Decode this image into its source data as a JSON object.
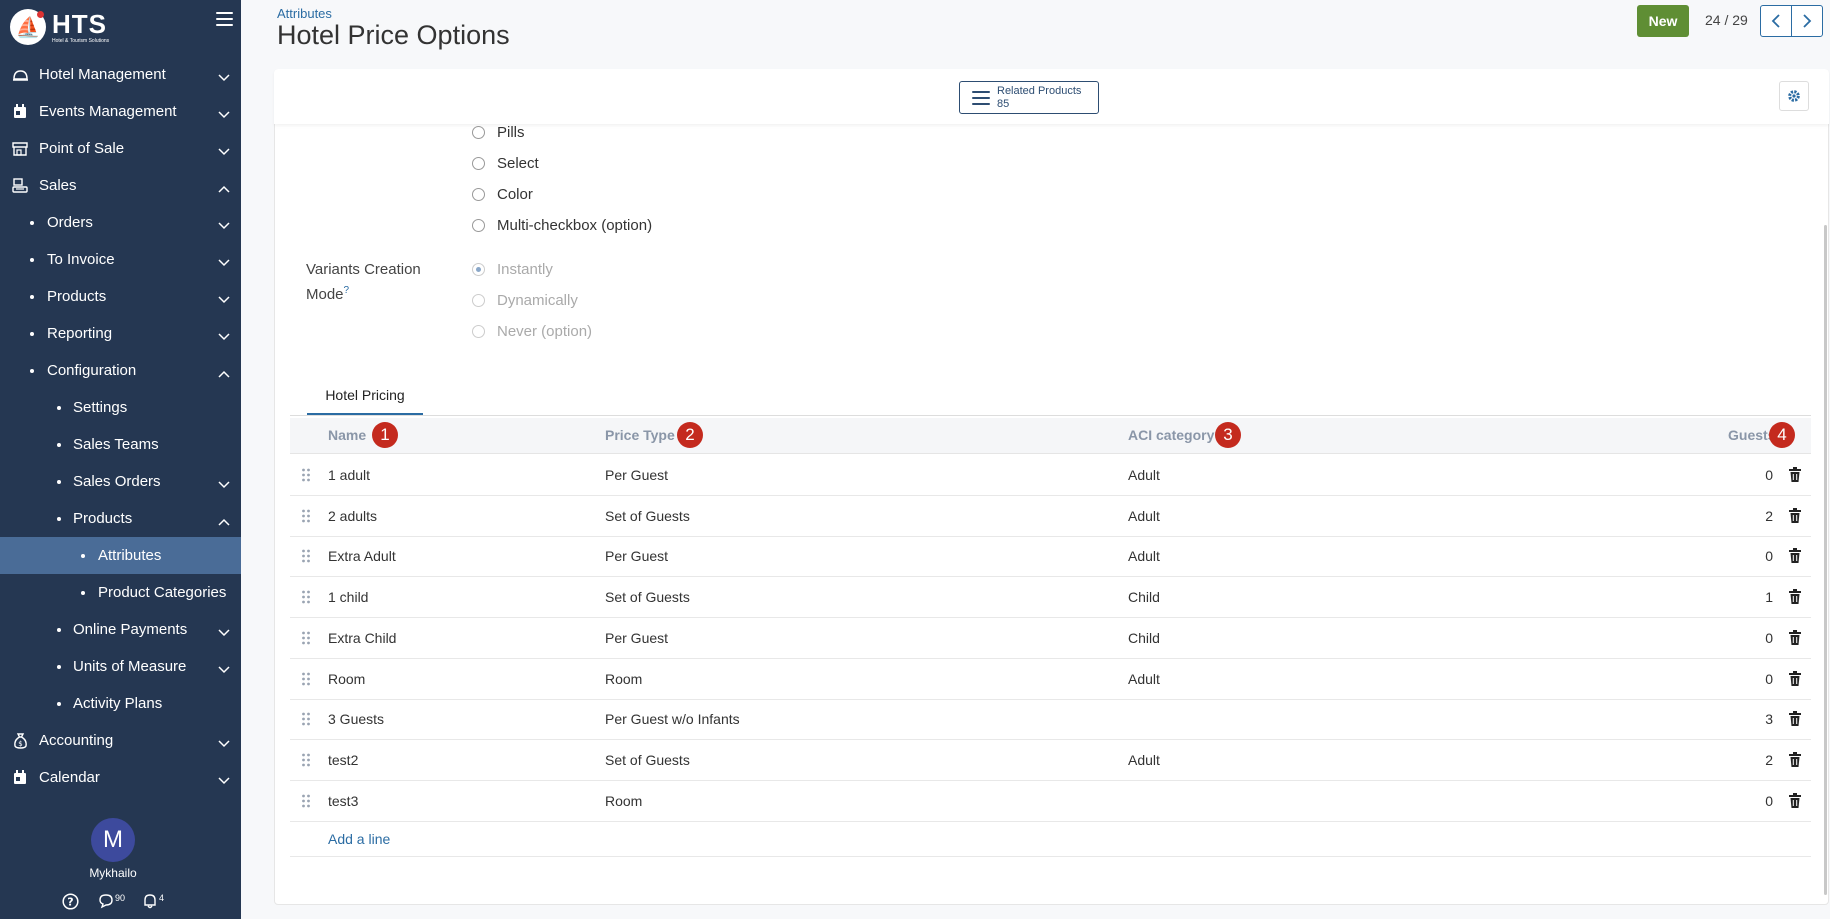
{
  "app": {
    "logo_text": "HTS",
    "logo_subtitle": "Hotel & Tourism Solutions"
  },
  "sidebar": {
    "items": [
      {
        "label": "Hotel Management",
        "icon": "bell-hotel-icon",
        "level": 0,
        "expanded": false
      },
      {
        "label": "Events Management",
        "icon": "calendar-icon",
        "level": 0,
        "expanded": false
      },
      {
        "label": "Point of Sale",
        "icon": "store-icon",
        "level": 0,
        "expanded": false
      },
      {
        "label": "Sales",
        "icon": "sales-icon",
        "level": 0,
        "expanded": true
      },
      {
        "label": "Orders",
        "level": 1,
        "expanded": false
      },
      {
        "label": "To Invoice",
        "level": 1,
        "expanded": false
      },
      {
        "label": "Products",
        "level": 1,
        "expanded": false
      },
      {
        "label": "Reporting",
        "level": 1,
        "expanded": false
      },
      {
        "label": "Configuration",
        "level": 1,
        "expanded": true
      },
      {
        "label": "Settings",
        "level": 2
      },
      {
        "label": "Sales Teams",
        "level": 2
      },
      {
        "label": "Sales Orders",
        "level": 2,
        "expanded": false
      },
      {
        "label": "Products",
        "level": 2,
        "expanded": true
      },
      {
        "label": "Attributes",
        "level": 3,
        "active": true
      },
      {
        "label": "Product Categories",
        "level": 3
      },
      {
        "label": "Online Payments",
        "level": 2,
        "expanded": false
      },
      {
        "label": "Units of Measure",
        "level": 2,
        "expanded": false
      },
      {
        "label": "Activity Plans",
        "level": 2
      },
      {
        "label": "Accounting",
        "icon": "money-bag-icon",
        "level": 0,
        "expanded": false
      },
      {
        "label": "Calendar",
        "icon": "calendar-icon",
        "level": 0,
        "expanded": false
      }
    ],
    "user": {
      "initial": "M",
      "name": "Mykhailo"
    },
    "messages_count": "90",
    "notifications_count": "4"
  },
  "header": {
    "breadcrumb": "Attributes",
    "title": "Hotel Price Options",
    "new_label": "New",
    "pager": "24 / 29"
  },
  "toolbar": {
    "related_label": "Related Products",
    "related_count": "85"
  },
  "display_options": [
    "Pills",
    "Select",
    "Color",
    "Multi-checkbox (option)"
  ],
  "variants": {
    "label": "Variants Creation Mode",
    "help": "?",
    "options": [
      "Instantly",
      "Dynamically",
      "Never (option)"
    ],
    "selected": "Instantly"
  },
  "tabs": [
    {
      "label": "Hotel Pricing",
      "active": true
    }
  ],
  "table": {
    "columns": [
      {
        "label": "Name",
        "badge": "1"
      },
      {
        "label": "Price Type",
        "badge": "2"
      },
      {
        "label": "ACI category",
        "badge": "3"
      },
      {
        "label": "Guests",
        "badge": "4"
      }
    ],
    "rows": [
      {
        "name": "1 adult",
        "price_type": "Per Guest",
        "category": "Adult",
        "guests": "0"
      },
      {
        "name": "2 adults",
        "price_type": "Set of Guests",
        "category": "Adult",
        "guests": "2"
      },
      {
        "name": "Extra Adult",
        "price_type": "Per Guest",
        "category": "Adult",
        "guests": "0"
      },
      {
        "name": "1 child",
        "price_type": "Set of Guests",
        "category": "Child",
        "guests": "1"
      },
      {
        "name": "Extra Child",
        "price_type": "Per Guest",
        "category": "Child",
        "guests": "0"
      },
      {
        "name": "Room",
        "price_type": "Room",
        "category": "Adult",
        "guests": "0"
      },
      {
        "name": "3 Guests",
        "price_type": "Per Guest w/o Infants",
        "category": "",
        "guests": "3"
      },
      {
        "name": "test2",
        "price_type": "Set of Guests",
        "category": "Adult",
        "guests": "2"
      },
      {
        "name": "test3",
        "price_type": "Room",
        "category": "",
        "guests": "0"
      }
    ],
    "add_line_label": "Add a line"
  },
  "colors": {
    "sidebar": "#253752",
    "active": "#4a6c97",
    "primary": "#5f8e34",
    "link": "#2b6ca3",
    "badge": "#c42a1e"
  }
}
